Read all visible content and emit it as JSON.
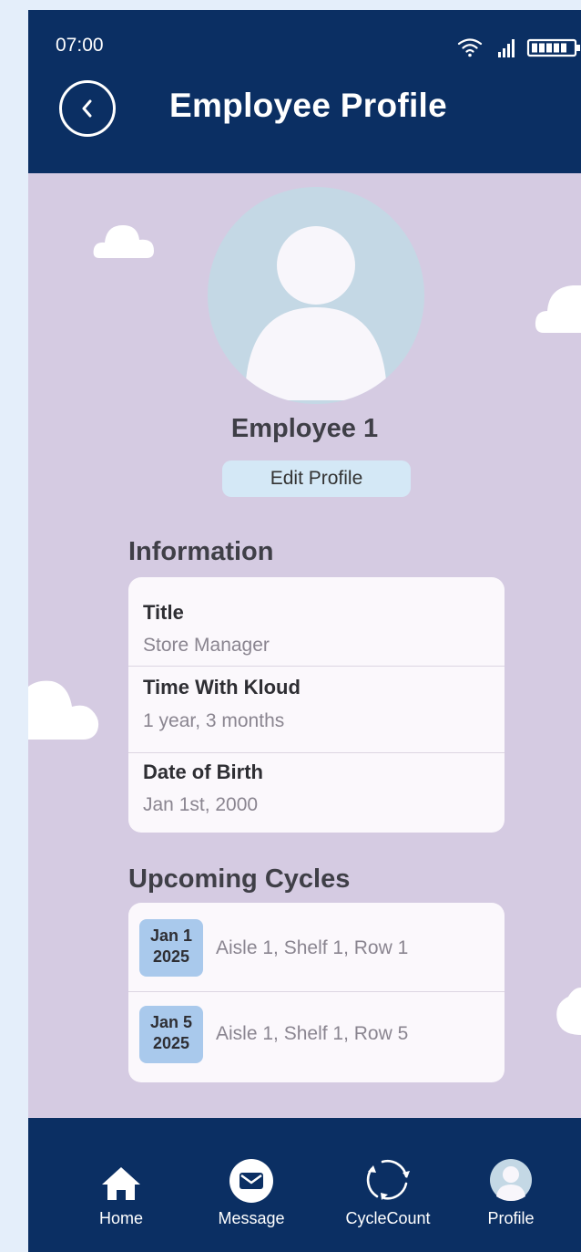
{
  "status_bar": {
    "time": "07:00"
  },
  "header": {
    "title": "Employee Profile"
  },
  "profile": {
    "name": "Employee 1",
    "edit_label": "Edit Profile"
  },
  "information": {
    "heading": "Information",
    "rows": [
      {
        "label": "Title",
        "value": "Store Manager"
      },
      {
        "label": "Time With Kloud",
        "value": "1 year, 3 months"
      },
      {
        "label": "Date of Birth",
        "value": "Jan 1st, 2000"
      }
    ]
  },
  "cycles": {
    "heading": "Upcoming Cycles",
    "items": [
      {
        "date_line1": "Jan 1",
        "date_line2": "2025",
        "location": "Aisle 1, Shelf 1, Row 1"
      },
      {
        "date_line1": "Jan 5",
        "date_line2": "2025",
        "location": "Aisle 1, Shelf 1, Row 5"
      }
    ]
  },
  "nav": {
    "items": [
      {
        "label": "Home",
        "icon": "home-icon"
      },
      {
        "label": "Message",
        "icon": "message-icon"
      },
      {
        "label": "CycleCount",
        "icon": "cycle-icon"
      },
      {
        "label": "Profile",
        "icon": "profile-icon"
      }
    ]
  },
  "colors": {
    "header_bg": "#0b2f63",
    "page_bg": "#d5cbe2",
    "card_bg": "#fbf8fc",
    "badge_bg": "#a9c9ec",
    "edit_bg": "#d4e8f6"
  }
}
